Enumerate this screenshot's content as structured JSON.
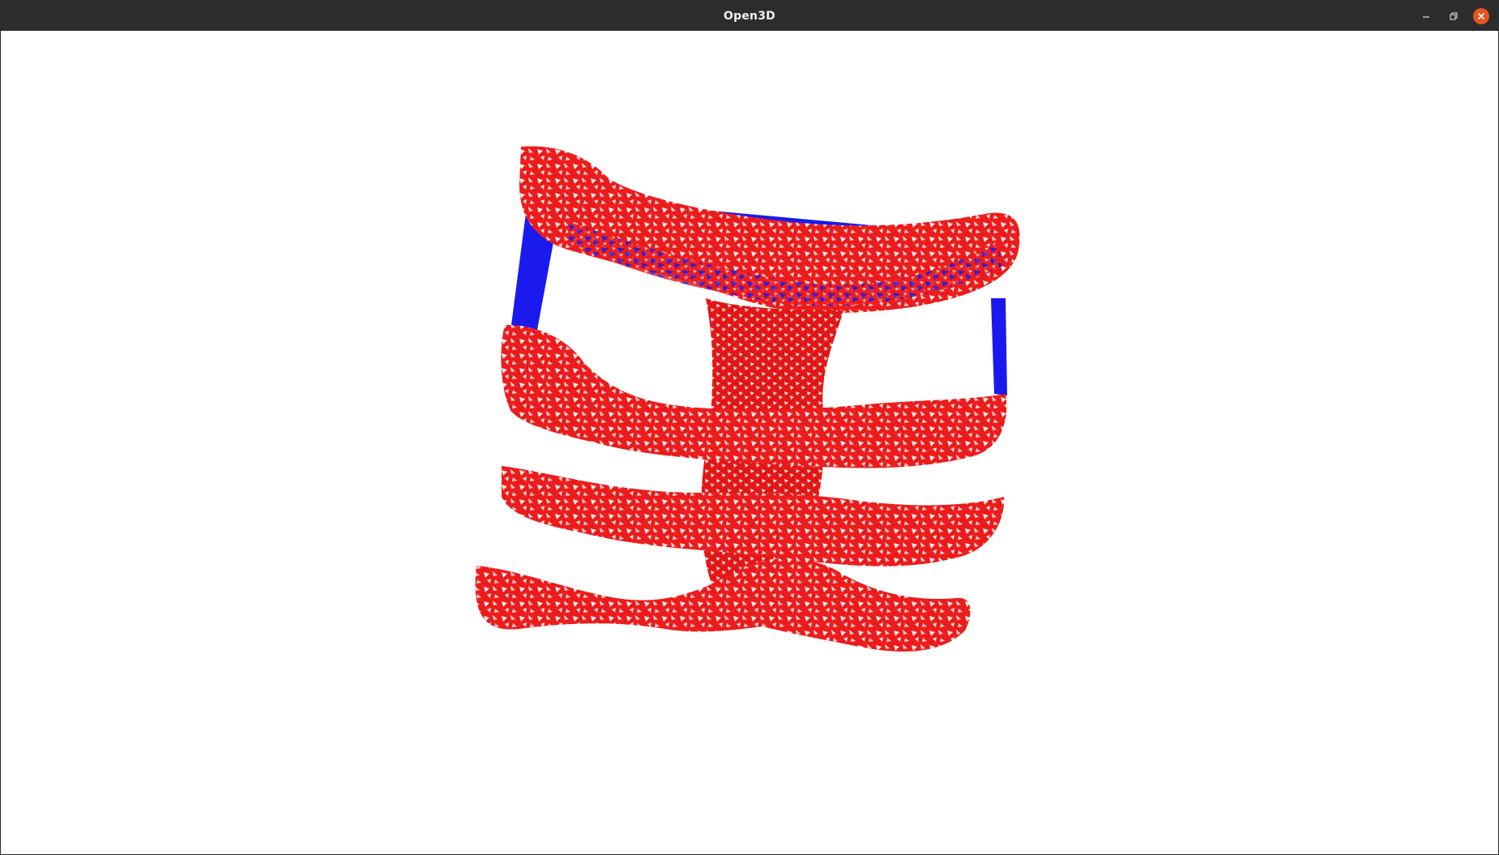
{
  "window": {
    "title": "Open3D",
    "controls": {
      "minimize_icon": "minimize-icon",
      "restore_icon": "restore-icon",
      "close_icon": "close-icon"
    }
  },
  "viewport": {
    "background": "#ffffff",
    "content": "3d-triangle-mesh",
    "colors": {
      "mesh_primary": "#ee1c1c",
      "mesh_secondary": "#1a1aee",
      "wireframe_gaps": "#ffffff"
    }
  },
  "colors": {
    "titlebar": "#2c2c2c",
    "title_text": "#f0f0f0",
    "close_button": "#e95420"
  }
}
